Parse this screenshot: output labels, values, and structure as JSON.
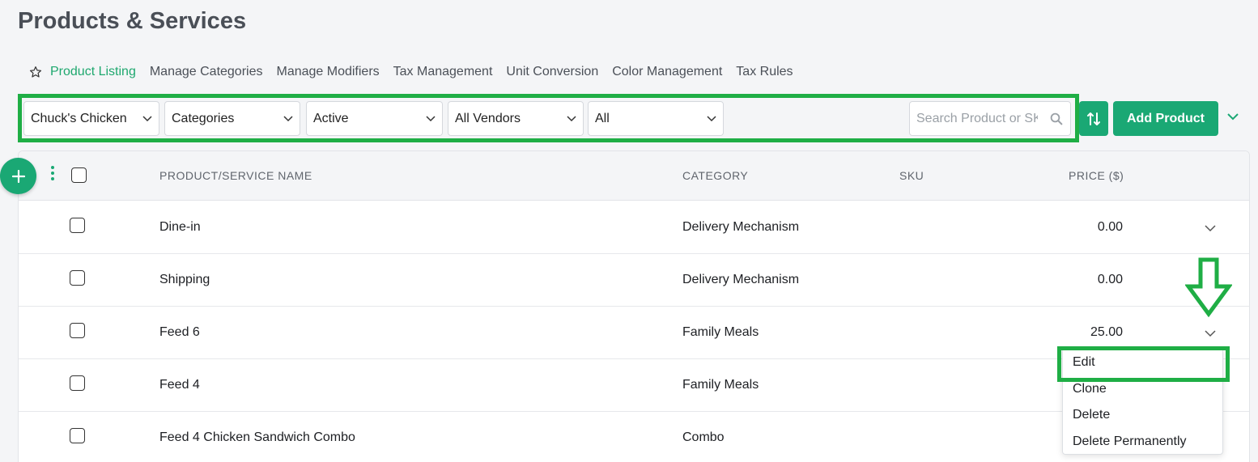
{
  "page": {
    "title": "Products & Services"
  },
  "tabs": [
    {
      "label": "Product Listing",
      "active": true
    },
    {
      "label": "Manage Categories"
    },
    {
      "label": "Manage Modifiers"
    },
    {
      "label": "Tax Management"
    },
    {
      "label": "Unit Conversion"
    },
    {
      "label": "Color Management"
    },
    {
      "label": "Tax Rules"
    }
  ],
  "filters": {
    "location": "Chuck's Chicken",
    "category": "Categories",
    "status": "Active",
    "vendor": "All Vendors",
    "type": "All"
  },
  "search": {
    "placeholder": "Search Product or SKU"
  },
  "toolbar": {
    "add_product_label": "Add Product"
  },
  "table": {
    "headers": {
      "name": "PRODUCT/SERVICE NAME",
      "category": "CATEGORY",
      "sku": "SKU",
      "price": "PRICE ($)"
    },
    "rows": [
      {
        "name": "Dine-in",
        "category": "Delivery Mechanism",
        "sku": "",
        "price": "0.00"
      },
      {
        "name": "Shipping",
        "category": "Delivery Mechanism",
        "sku": "",
        "price": "0.00"
      },
      {
        "name": "Feed 6",
        "category": "Family Meals",
        "sku": "",
        "price": "25.00"
      },
      {
        "name": "Feed 4",
        "category": "Family Meals",
        "sku": "",
        "price": ""
      },
      {
        "name": "Feed 4 Chicken Sandwich Combo",
        "category": "Combo",
        "sku": "",
        "price": ""
      }
    ]
  },
  "row_menu": {
    "items": [
      "Edit",
      "Clone",
      "Delete",
      "Delete Permanently"
    ]
  },
  "colors": {
    "accent": "#1aa874",
    "active_tab": "#1fa86f",
    "highlight": "#1fae45"
  },
  "icons": {
    "tab_favorite": "star-icon",
    "fab": "plus-icon",
    "bulk_menu": "kebab-icon",
    "sort": "sort-icon",
    "search": "search-icon",
    "dropdown": "chevron-down-icon",
    "annotation": "arrow-down-icon"
  }
}
